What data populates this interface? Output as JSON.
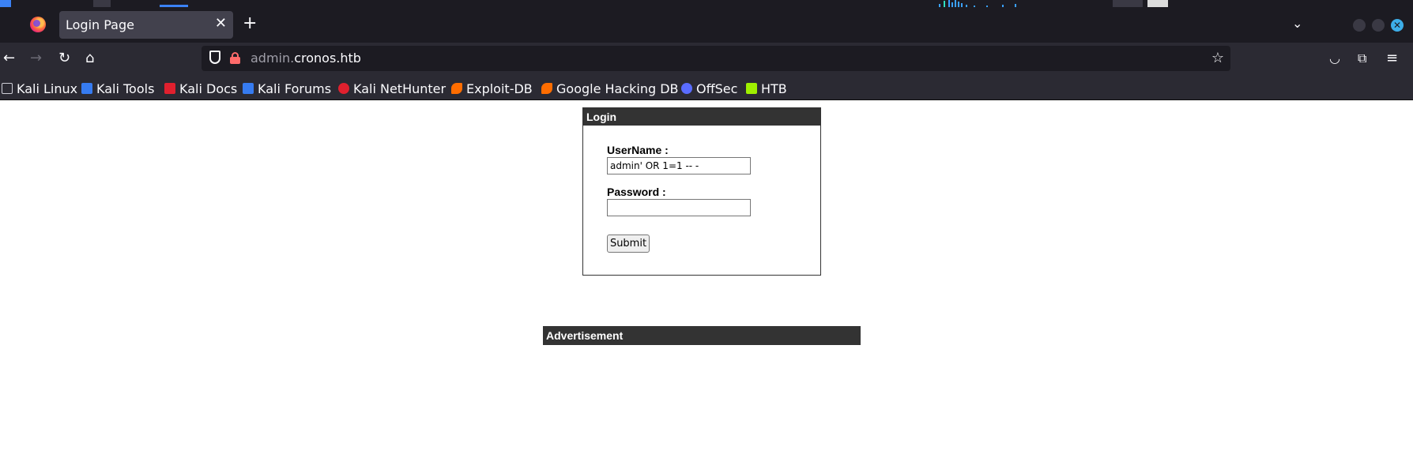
{
  "browser": {
    "tab": {
      "title": "Login Page",
      "close_icon": "close-icon"
    },
    "new_tab_icon": "plus-icon",
    "url": {
      "subdomain": "admin.",
      "domain": "cronos.htb"
    },
    "bookmarks": [
      {
        "label": "Kali Linux",
        "icon_color": "#2b2a33"
      },
      {
        "label": "Kali Tools",
        "icon_color": "#367bf0"
      },
      {
        "label": "Kali Docs",
        "icon_color": "#e0202e"
      },
      {
        "label": "Kali Forums",
        "icon_color": "#367bf0"
      },
      {
        "label": "Kali NetHunter",
        "icon_color": "#e0202e"
      },
      {
        "label": "Exploit-DB",
        "icon_color": "#ff6d00"
      },
      {
        "label": "Google Hacking DB",
        "icon_color": "#ff6d00"
      },
      {
        "label": "OffSec",
        "icon_color": "#5a6cff"
      },
      {
        "label": "HTB",
        "icon_color": "#9fef00"
      }
    ]
  },
  "login": {
    "header": "Login",
    "username_label": "UserName :",
    "username_value": "admin' OR 1=1 -- -",
    "password_label": "Password :",
    "password_value": "",
    "submit_label": "Submit"
  },
  "advertisement": {
    "header": "Advertisement"
  }
}
